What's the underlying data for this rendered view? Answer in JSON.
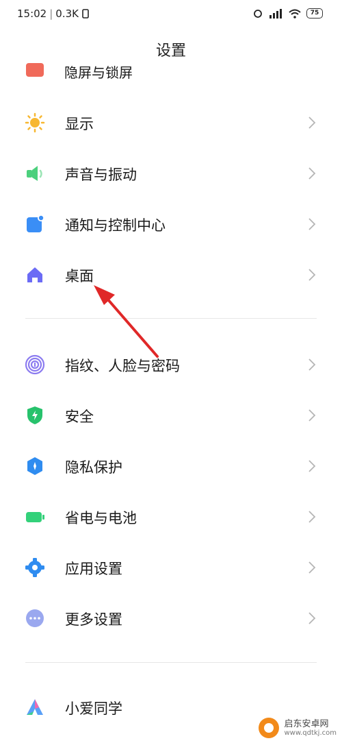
{
  "status": {
    "time": "15:02",
    "network_speed": "0.3K",
    "battery": "75"
  },
  "header": {
    "title": "设置"
  },
  "partial_item": {
    "label": "隐屏与锁屏"
  },
  "items": [
    {
      "label": "显示",
      "icon": "sun-icon",
      "color": "#f7b731"
    },
    {
      "label": "声音与振动",
      "icon": "speaker-icon",
      "color": "#4cd07d"
    },
    {
      "label": "通知与控制中心",
      "icon": "notification-icon",
      "color": "#3a8ef6"
    },
    {
      "label": "桌面",
      "icon": "home-icon",
      "color": "#6b6bf5"
    },
    {
      "label": "指纹、人脸与密码",
      "icon": "fingerprint-icon",
      "color": "#8c7cf0"
    },
    {
      "label": "安全",
      "icon": "shield-icon",
      "color": "#27c26c"
    },
    {
      "label": "隐私保护",
      "icon": "privacy-icon",
      "color": "#2f8cf0"
    },
    {
      "label": "省电与电池",
      "icon": "battery-icon",
      "color": "#33d17a"
    },
    {
      "label": "应用设置",
      "icon": "gear-icon",
      "color": "#2f8cf0"
    },
    {
      "label": "更多设置",
      "icon": "more-icon",
      "color": "#9aa8ef"
    },
    {
      "label": "小爱同学",
      "icon": "xiaoai-icon",
      "color": "#5aa0f7"
    }
  ],
  "watermark": {
    "name": "启东安卓网",
    "url": "www.qdtkj.com"
  }
}
